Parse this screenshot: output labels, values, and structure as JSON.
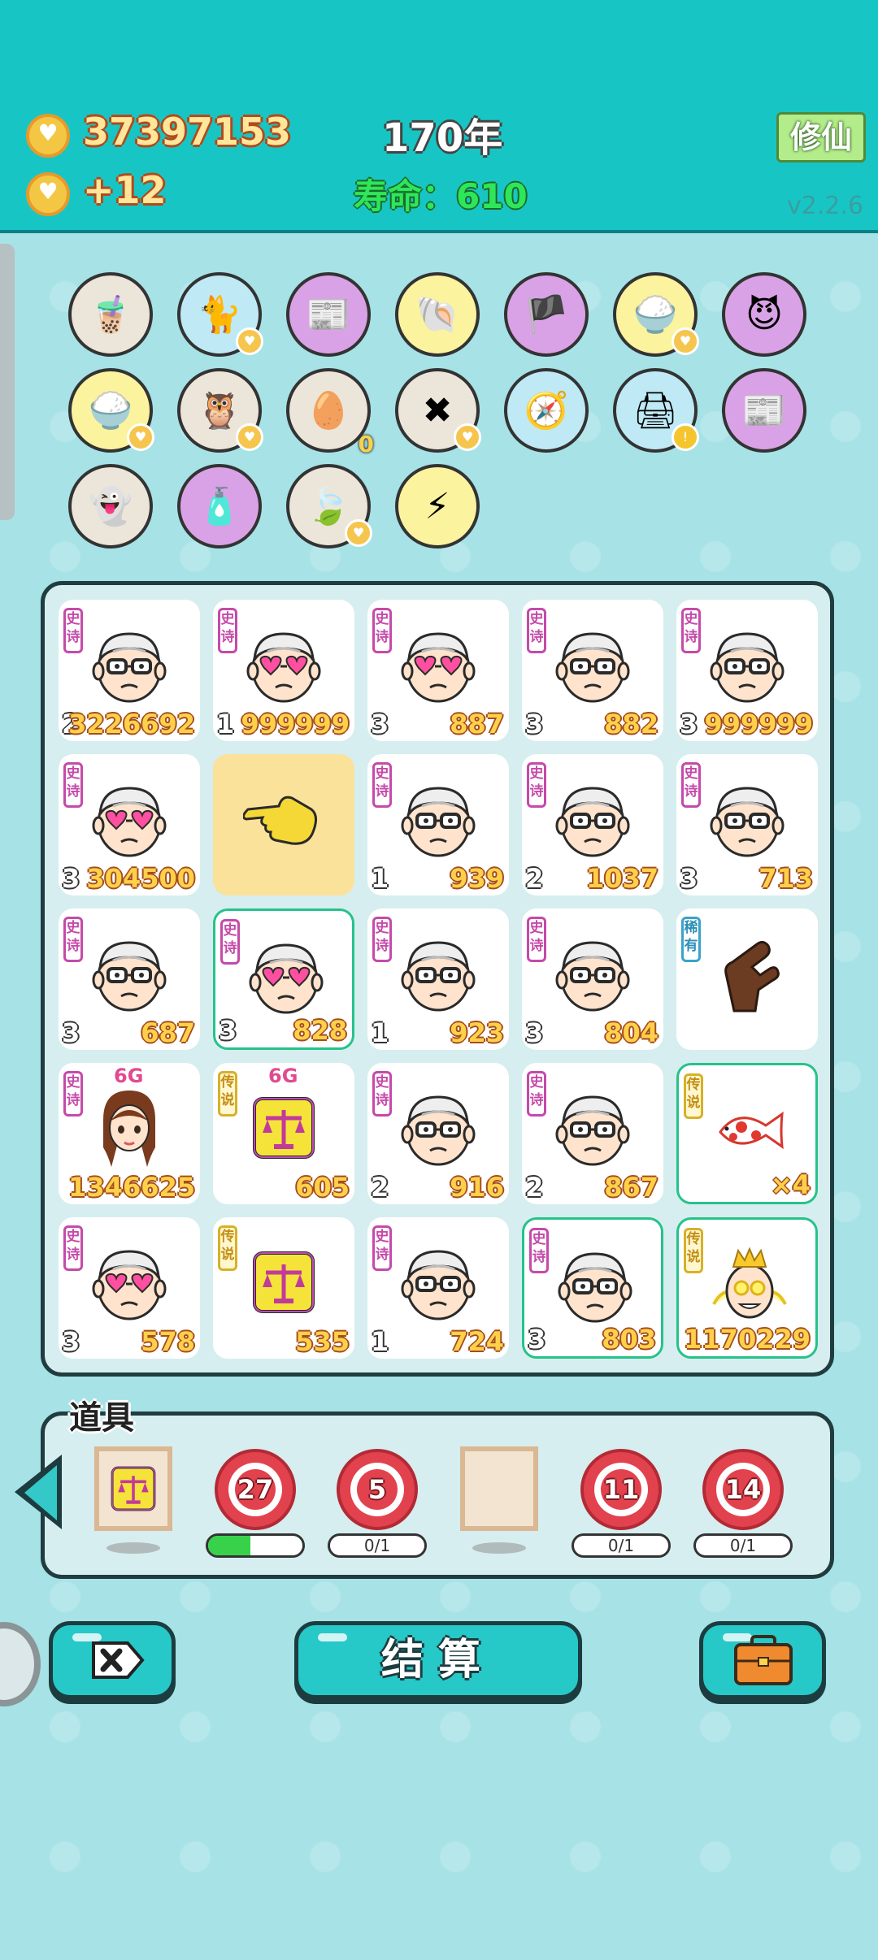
{
  "header": {
    "coins": "37397153",
    "coin_rate": "+12",
    "year": "170年",
    "lifespan_label": "寿命：",
    "lifespan_value": "610",
    "cultivate_button": "修仙",
    "version": "v2.2.6"
  },
  "symbols": [
    {
      "icon": "bubble-tea-icon",
      "bg": "#ece6da"
    },
    {
      "icon": "cat-icon",
      "bg": "#bfe9f5",
      "heart": true
    },
    {
      "icon": "time-magazine-icon",
      "bg": "#d9a2e6"
    },
    {
      "icon": "shell-icon",
      "bg": "#fbf39e"
    },
    {
      "icon": "eyepatch-pirate-icon",
      "bg": "#d9a2e6"
    },
    {
      "icon": "rice-bowl-icon",
      "bg": "#fbf39e",
      "heart": true
    },
    {
      "icon": "devil-card-icon",
      "bg": "#d9a2e6"
    },
    {
      "icon": "rice-bowl-icon",
      "bg": "#fbf39e",
      "heart": true
    },
    {
      "icon": "owls-icon",
      "bg": "#ece6da",
      "heart": true
    },
    {
      "icon": "egg-tray-icon",
      "bg": "#ece6da",
      "counter": "0"
    },
    {
      "icon": "delete-tag-icon",
      "bg": "#ece6da",
      "heart": true
    },
    {
      "icon": "compass-icon",
      "bg": "#bfe9f5"
    },
    {
      "icon": "printer-icon",
      "bg": "#bfe9f5",
      "warn": true
    },
    {
      "icon": "time-magazine-icon",
      "bg": "#d9a2e6"
    },
    {
      "icon": "ghost-icon",
      "bg": "#ece6da"
    },
    {
      "icon": "perfume-bottle-icon",
      "bg": "#d9a2e6"
    },
    {
      "icon": "leaf-icon",
      "bg": "#ece6da",
      "heart": true
    },
    {
      "icon": "lightning-icon",
      "bg": "#fbf39e"
    }
  ],
  "board": [
    [
      {
        "tag": "史诗",
        "face": "grandpa",
        "level": "2",
        "value": "3226692"
      },
      {
        "tag": "史诗",
        "face": "grandpa-heart",
        "level": "1",
        "value": "999999"
      },
      {
        "tag": "史诗",
        "face": "grandpa-heart",
        "level": "3",
        "value": "887"
      },
      {
        "tag": "史诗",
        "face": "grandpa",
        "level": "3",
        "value": "882"
      },
      {
        "tag": "史诗",
        "face": "grandpa",
        "level": "3",
        "value": "999999"
      }
    ],
    [
      {
        "tag": "史诗",
        "face": "grandpa-heart",
        "level": "3",
        "value": "304500"
      },
      {
        "tag": "",
        "face": "pointing-hand",
        "level": "",
        "value": "",
        "bg": "yellow"
      },
      {
        "tag": "史诗",
        "face": "grandpa",
        "level": "1",
        "value": "939"
      },
      {
        "tag": "史诗",
        "face": "grandpa",
        "level": "2",
        "value": "1037"
      },
      {
        "tag": "史诗",
        "face": "grandpa",
        "level": "3",
        "value": "713"
      }
    ],
    [
      {
        "tag": "史诗",
        "face": "grandpa",
        "level": "3",
        "value": "687"
      },
      {
        "tag": "史诗",
        "face": "grandpa-heart",
        "level": "3",
        "value": "828",
        "highlight": true
      },
      {
        "tag": "史诗",
        "face": "grandpa",
        "level": "1",
        "value": "923"
      },
      {
        "tag": "史诗",
        "face": "grandpa",
        "level": "3",
        "value": "804"
      },
      {
        "tag": "稀有",
        "face": "brown-finger",
        "level": "",
        "value": ""
      }
    ],
    [
      {
        "tag": "史诗",
        "face": "girl",
        "level": "",
        "value": "1346625",
        "badge": "6G"
      },
      {
        "tag": "传说",
        "face": "scale",
        "level": "",
        "value": "605",
        "badge": "6G"
      },
      {
        "tag": "史诗",
        "face": "grandpa",
        "level": "2",
        "value": "916"
      },
      {
        "tag": "史诗",
        "face": "grandpa",
        "level": "2",
        "value": "867"
      },
      {
        "tag": "传说",
        "face": "koi-fish",
        "level": "",
        "value": "×4",
        "highlight": true
      }
    ],
    [
      {
        "tag": "史诗",
        "face": "grandpa-heart",
        "level": "3",
        "value": "578"
      },
      {
        "tag": "传说",
        "face": "scale",
        "level": "",
        "value": "535"
      },
      {
        "tag": "史诗",
        "face": "grandpa",
        "level": "1",
        "value": "724"
      },
      {
        "tag": "史诗",
        "face": "grandpa",
        "level": "3",
        "value": "803",
        "highlight": true
      },
      {
        "tag": "传说",
        "face": "king",
        "level": "",
        "value": "1170229",
        "highlight": true
      }
    ]
  ],
  "items_panel": {
    "title": "道具",
    "items": [
      {
        "type": "frame",
        "icon": "scale-frame-icon",
        "progress": null
      },
      {
        "type": "target",
        "number": "27",
        "progress": 0.45,
        "progress_text": ""
      },
      {
        "type": "target",
        "number": "5",
        "progress": 0,
        "progress_text": "0/1"
      },
      {
        "type": "frame",
        "icon": "empty-frame-icon",
        "progress": null
      },
      {
        "type": "target",
        "number": "11",
        "progress": 0,
        "progress_text": "0/1"
      },
      {
        "type": "target",
        "number": "14",
        "progress": 0,
        "progress_text": "0/1"
      }
    ]
  },
  "buttons": {
    "delete": "delete-icon",
    "settle": "结算",
    "bag": "briefcase-icon"
  }
}
